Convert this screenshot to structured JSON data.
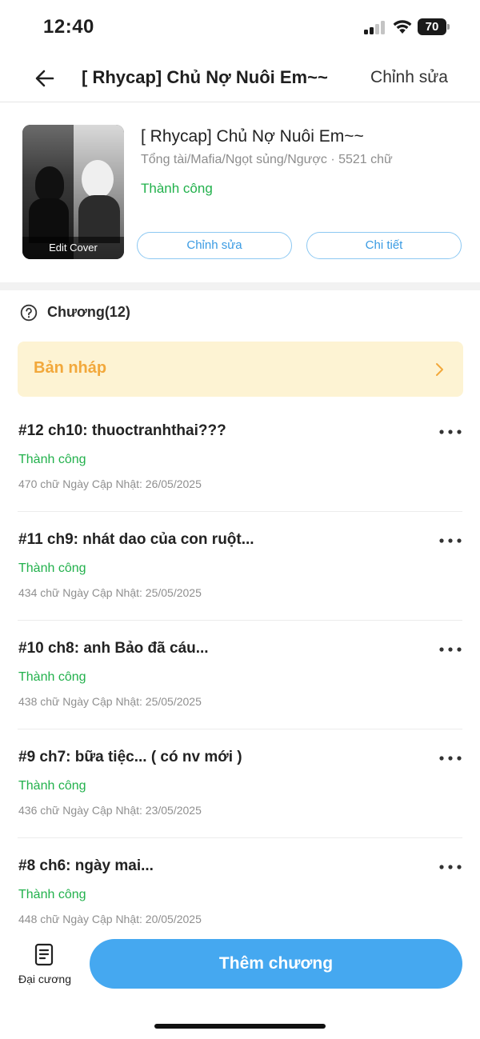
{
  "status_bar": {
    "time": "12:40",
    "battery": "70",
    "battery_level": 0.7
  },
  "nav": {
    "title": "[ Rhycap] Chủ Nợ Nuôi Em~~",
    "edit_label": "Chỉnh sửa"
  },
  "story": {
    "cover_caption": "Edit Cover",
    "title": "[ Rhycap] Chủ Nợ Nuôi Em~~",
    "meta": "Tổng tài/Mafia/Ngọt sủng/Ngược · 5521 chữ",
    "status": "Thành công",
    "edit_button": "Chỉnh sửa",
    "detail_button": "Chi tiết"
  },
  "chapters": {
    "header": "Chương(12)",
    "draft_label": "Bản nháp",
    "items": [
      {
        "title": "#12 ch10: thuoctranhthai???",
        "status": "Thành công",
        "meta": "470 chữ Ngày Cập Nhật: 26/05/2025"
      },
      {
        "title": "#11 ch9: nhát dao của con ruột...",
        "status": "Thành công",
        "meta": "434 chữ Ngày Cập Nhật: 25/05/2025"
      },
      {
        "title": "#10 ch8: anh Bảo đã cáu...",
        "status": "Thành công",
        "meta": "438 chữ Ngày Cập Nhật: 25/05/2025"
      },
      {
        "title": "#9 ch7: bữa tiệc... ( có nv mới )",
        "status": "Thành công",
        "meta": "436 chữ Ngày Cập Nhật: 23/05/2025"
      },
      {
        "title": "#8 ch6: ngày mai...",
        "status": "Thành công",
        "meta": "448 chữ Ngày Cập Nhật: 20/05/2025"
      }
    ]
  },
  "bottom": {
    "outline_label": "Đại cương",
    "add_chapter_label": "Thêm chương"
  },
  "colors": {
    "accent": "#45a8f0",
    "success": "#22b14c",
    "draft_bg": "#fdf3d3",
    "draft_text": "#f2a83b"
  }
}
